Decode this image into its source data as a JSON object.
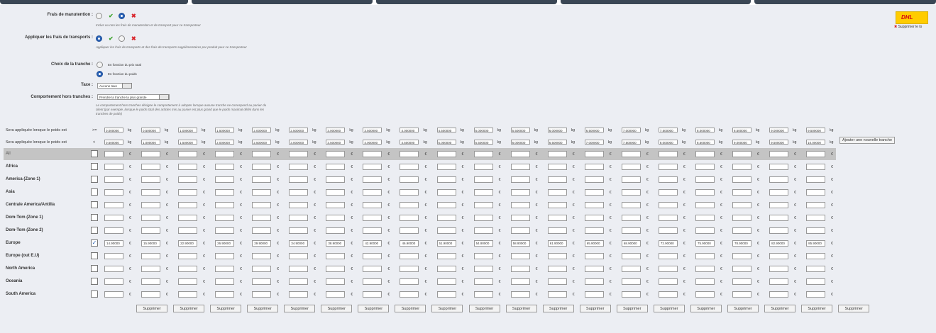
{
  "form": {
    "handling": {
      "label": "Frais de manutention :",
      "hint": "Inclus ou non les frais de manutention et de transport pour ce transporteur",
      "options": [
        "non",
        "oui"
      ],
      "selected": "oui"
    },
    "apply_fees": {
      "label": "Appliquer les frais de transports :",
      "hint": "Appliquer les frais de transports et des frais de transports supplémentaires par produit pour ce transporteur",
      "selected": "oui"
    },
    "range_choice": {
      "label": "Choix de la tranche :",
      "options": [
        "En fonction du prix total",
        "En fonction du poids"
      ],
      "selected": "En fonction du poids"
    },
    "tax": {
      "label": "Taxe :",
      "value": "Aucune taxe"
    },
    "out_of_range": {
      "label": "Comportement hors tranches :",
      "value": "Prendre la tranche la plus grande",
      "hint": "Le comportement hors tranches désigne le comportement à adopter lorsque aucune tranche ne correspond au panier du client (par exemple, lorsque le poids total des articles mis au panier est plus grand que le poids maximal défini dans les tranches de poids)"
    }
  },
  "carrier": {
    "logo_text": "DHL",
    "delete_logo_label": "Supprimer le lo"
  },
  "weights": {
    "from_label": "Sera appliquée lorsque le poids est",
    "from_op": ">=",
    "to_label": "Sera appliquée lorsque le poids est",
    "to_op": "<",
    "unit": "kg",
    "from": [
      "0.000000",
      "0.500000",
      "1.000000",
      "1.500000",
      "2.000000",
      "2.500000",
      "3.000000",
      "3.500000",
      "4.000000",
      "4.500000",
      "5.000000",
      "5.500000",
      "6.000000",
      "6.500000",
      "7.000000",
      "7.500000",
      "8.000000",
      "8.500000",
      "9.000000",
      "9.500000"
    ],
    "to": [
      "0.500000",
      "1.000000",
      "1.500000",
      "2.000000",
      "2.500000",
      "3.000000",
      "3.500000",
      "4.000000",
      "4.500000",
      "5.000000",
      "5.500000",
      "6.000000",
      "6.500000",
      "7.000000",
      "7.500000",
      "8.000000",
      "8.500000",
      "9.000000",
      "9.500000",
      "10.00000"
    ],
    "add_button": "Ajouter une nouvelle tranche"
  },
  "zones": [
    {
      "name": "All",
      "checked": false,
      "prices": []
    },
    {
      "name": "Africa",
      "checked": false,
      "prices": []
    },
    {
      "name": "America (Zone 1)",
      "checked": false,
      "prices": []
    },
    {
      "name": "Asia",
      "checked": false,
      "prices": []
    },
    {
      "name": "Centrale America/Antilla",
      "checked": false,
      "prices": []
    },
    {
      "name": "Dom-Tom (Zone 1)",
      "checked": false,
      "prices": []
    },
    {
      "name": "Dom-Tom (Zone 2)",
      "checked": false,
      "prices": []
    },
    {
      "name": "Europe",
      "checked": true,
      "prices": [
        "14.90000",
        "15.90000",
        "22.90000",
        "26.90000",
        "29.90000",
        "34.90000",
        "38.90000",
        "42.90000",
        "46.90000",
        "51.90000",
        "54.90000",
        "58.90000",
        "61.90000",
        "65.90000",
        "68.90000",
        "72.90000",
        "75.90000",
        "78.90000",
        "82.90000",
        "85.90000"
      ]
    },
    {
      "name": "Europe (out E.U)",
      "checked": false,
      "prices": []
    },
    {
      "name": "North America",
      "checked": false,
      "prices": []
    },
    {
      "name": "Oceania",
      "checked": false,
      "prices": []
    },
    {
      "name": "South America",
      "checked": false,
      "prices": []
    }
  ],
  "currency": "€",
  "delete_label": "Supprimer"
}
